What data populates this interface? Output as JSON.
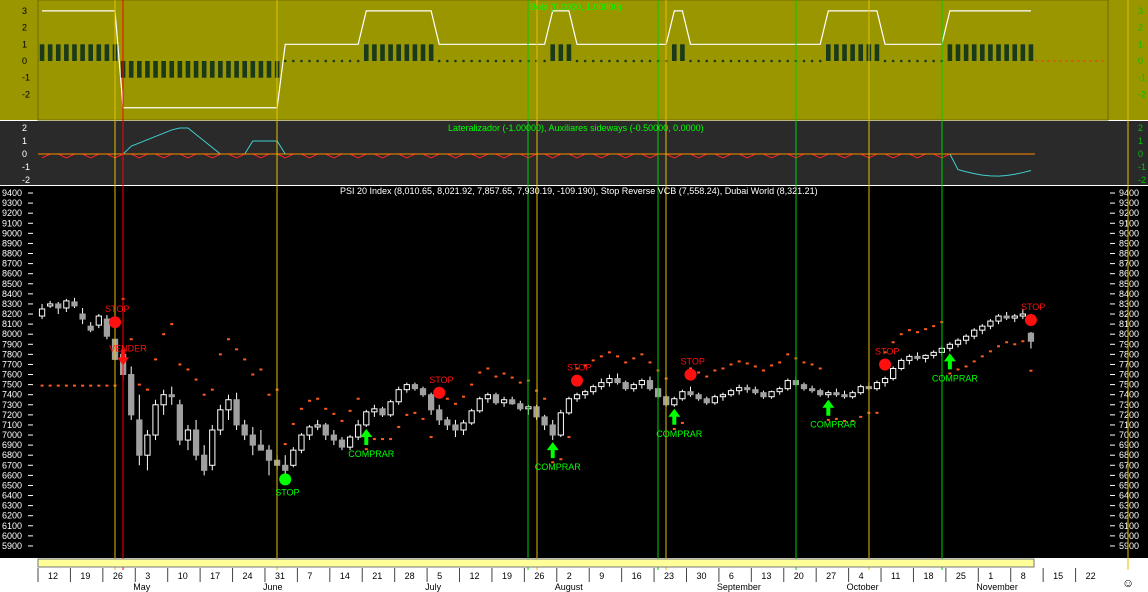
{
  "panels": {
    "top_label": "Bobi (0.0000, 1.00000)",
    "mid_label": "Lateralizador (-1.00000), Auxiliares sideways (-0.50000, 0.0000)",
    "main_label": "PSI 20 Index (8,010.65, 8,021.92, 7,857.65, 7,930.19, -109.190), Stop Reverse VCB (7,558.24), Dubai World (8,321.21)"
  },
  "colors": {
    "olive": "#9a9600",
    "mid_bg": "#2a2a2a",
    "main_bg": "#000000",
    "signal_green": "#00ff00",
    "stop_red": "#ff1010",
    "stop_dots": "#ff5a1e",
    "vline_yellow": "#e0c000",
    "vline_green": "#00d000",
    "vline_red": "#ff0000"
  },
  "chart_data": {
    "type": "candlestick",
    "title": "PSI 20 Index (8,010.65, 8,021.92, 7,857.65, 7,930.19, -109.190), Stop Reverse VCB (7,558.24), Dubai World (8,321.21)",
    "y_ticks": [
      9400,
      9300,
      9200,
      9100,
      9000,
      8900,
      8800,
      8700,
      8600,
      8500,
      8400,
      8300,
      8200,
      8100,
      8000,
      7900,
      7800,
      7700,
      7600,
      7500,
      7400,
      7300,
      7200,
      7100,
      7000,
      6900,
      6800,
      6700,
      6600,
      6500,
      6400,
      6300,
      6200,
      6100,
      6000,
      5900
    ],
    "ylim": [
      5850,
      9420
    ],
    "x_day_labels": [
      "12",
      "19",
      "26",
      "3",
      "10",
      "17",
      "24",
      "31",
      "7",
      "14",
      "21",
      "28",
      "5",
      "12",
      "19",
      "26",
      "2",
      "9",
      "16",
      "23",
      "30",
      "6",
      "13",
      "20",
      "27",
      "4",
      "11",
      "18",
      "25",
      "1",
      "8",
      "15",
      "22"
    ],
    "month_labels": [
      "May",
      "June",
      "July",
      "August",
      "September",
      "October",
      "November"
    ],
    "top_panel": {
      "y_ticks": [
        "3",
        "2",
        "1",
        "0",
        "-1",
        "-2"
      ]
    },
    "mid_panel": {
      "y_ticks": [
        "2",
        "1",
        "0",
        "-1",
        "-2"
      ]
    },
    "candles": [
      [
        8180,
        8300,
        8150,
        8250
      ],
      [
        8280,
        8330,
        8260,
        8300
      ],
      [
        8300,
        8320,
        8200,
        8260
      ],
      [
        8260,
        8350,
        8220,
        8330
      ],
      [
        8320,
        8360,
        8260,
        8280
      ],
      [
        8200,
        8260,
        8100,
        8150
      ],
      [
        8080,
        8120,
        8020,
        8040
      ],
      [
        8090,
        8200,
        8060,
        8180
      ],
      [
        8150,
        8190,
        7950,
        7980
      ],
      [
        7950,
        8000,
        7700,
        7750
      ],
      [
        7800,
        7850,
        7550,
        7600
      ],
      [
        7600,
        7680,
        7150,
        7200
      ],
      [
        7150,
        7400,
        6700,
        6800
      ],
      [
        6800,
        7050,
        6650,
        7000
      ],
      [
        7000,
        7350,
        6950,
        7300
      ],
      [
        7300,
        7450,
        7200,
        7400
      ],
      [
        7400,
        7480,
        7300,
        7380
      ],
      [
        7300,
        7350,
        6900,
        6950
      ],
      [
        6950,
        7100,
        6850,
        7050
      ],
      [
        7050,
        7150,
        6750,
        6800
      ],
      [
        6800,
        6900,
        6600,
        6650
      ],
      [
        6700,
        7100,
        6650,
        7050
      ],
      [
        7050,
        7300,
        7000,
        7250
      ],
      [
        7250,
        7400,
        7150,
        7350
      ],
      [
        7350,
        7420,
        7050,
        7100
      ],
      [
        7100,
        7150,
        6950,
        7000
      ],
      [
        7000,
        7080,
        6800,
        6900
      ],
      [
        6900,
        7050,
        6850,
        6850
      ],
      [
        6850,
        6900,
        6600,
        6750
      ],
      [
        6750,
        6800,
        6650,
        6700
      ],
      [
        6700,
        6800,
        6600,
        6650
      ],
      [
        6700,
        6880,
        6680,
        6850
      ],
      [
        6850,
        7020,
        6820,
        7000
      ],
      [
        7000,
        7100,
        6950,
        7080
      ],
      [
        7080,
        7150,
        7050,
        7100
      ],
      [
        7100,
        7120,
        6950,
        7000
      ],
      [
        7000,
        7050,
        6900,
        6950
      ],
      [
        6950,
        6980,
        6850,
        6880
      ],
      [
        6880,
        7000,
        6850,
        6980
      ],
      [
        6980,
        7150,
        6950,
        7100
      ],
      [
        7100,
        7250,
        7080,
        7230
      ],
      [
        7230,
        7300,
        7180,
        7260
      ],
      [
        7260,
        7280,
        7180,
        7200
      ],
      [
        7200,
        7350,
        7180,
        7330
      ],
      [
        7330,
        7480,
        7300,
        7450
      ],
      [
        7450,
        7520,
        7420,
        7500
      ],
      [
        7500,
        7520,
        7440,
        7460
      ],
      [
        7460,
        7480,
        7380,
        7400
      ],
      [
        7400,
        7420,
        7200,
        7250
      ],
      [
        7250,
        7300,
        7100,
        7150
      ],
      [
        7150,
        7180,
        7050,
        7100
      ],
      [
        7100,
        7150,
        6980,
        7050
      ],
      [
        7050,
        7150,
        7000,
        7120
      ],
      [
        7120,
        7260,
        7100,
        7240
      ],
      [
        7240,
        7380,
        7220,
        7360
      ],
      [
        7360,
        7420,
        7320,
        7400
      ],
      [
        7400,
        7420,
        7300,
        7320
      ],
      [
        7320,
        7380,
        7280,
        7350
      ],
      [
        7350,
        7380,
        7300,
        7310
      ],
      [
        7310,
        7340,
        7240,
        7260
      ],
      [
        7260,
        7300,
        7200,
        7280
      ],
      [
        7280,
        7300,
        7150,
        7180
      ],
      [
        7180,
        7200,
        7050,
        7100
      ],
      [
        7100,
        7150,
        6950,
        7000
      ],
      [
        7000,
        7250,
        6980,
        7220
      ],
      [
        7220,
        7380,
        7200,
        7360
      ],
      [
        7360,
        7420,
        7330,
        7400
      ],
      [
        7400,
        7450,
        7360,
        7430
      ],
      [
        7430,
        7500,
        7400,
        7480
      ],
      [
        7480,
        7560,
        7450,
        7520
      ],
      [
        7520,
        7600,
        7480,
        7560
      ],
      [
        7560,
        7610,
        7500,
        7520
      ],
      [
        7520,
        7540,
        7440,
        7460
      ],
      [
        7460,
        7520,
        7430,
        7500
      ],
      [
        7500,
        7560,
        7460,
        7540
      ],
      [
        7540,
        7580,
        7440,
        7460
      ],
      [
        7460,
        7480,
        7360,
        7380
      ],
      [
        7380,
        7400,
        7280,
        7300
      ],
      [
        7300,
        7380,
        7280,
        7360
      ],
      [
        7360,
        7450,
        7340,
        7430
      ],
      [
        7430,
        7480,
        7380,
        7400
      ],
      [
        7400,
        7420,
        7340,
        7360
      ],
      [
        7360,
        7380,
        7300,
        7320
      ],
      [
        7320,
        7400,
        7300,
        7380
      ],
      [
        7380,
        7420,
        7340,
        7400
      ],
      [
        7400,
        7460,
        7380,
        7440
      ],
      [
        7440,
        7500,
        7400,
        7470
      ],
      [
        7470,
        7500,
        7420,
        7450
      ],
      [
        7450,
        7480,
        7400,
        7420
      ],
      [
        7420,
        7440,
        7360,
        7380
      ],
      [
        7380,
        7440,
        7360,
        7430
      ],
      [
        7430,
        7480,
        7400,
        7460
      ],
      [
        7460,
        7560,
        7440,
        7540
      ],
      [
        7540,
        7580,
        7480,
        7500
      ],
      [
        7500,
        7520,
        7440,
        7460
      ],
      [
        7460,
        7490,
        7420,
        7440
      ],
      [
        7440,
        7460,
        7380,
        7400
      ],
      [
        7400,
        7440,
        7370,
        7420
      ],
      [
        7420,
        7460,
        7380,
        7400
      ],
      [
        7400,
        7440,
        7360,
        7380
      ],
      [
        7380,
        7440,
        7360,
        7420
      ],
      [
        7420,
        7500,
        7400,
        7480
      ],
      [
        7480,
        7520,
        7440,
        7460
      ],
      [
        7460,
        7540,
        7440,
        7520
      ],
      [
        7520,
        7580,
        7480,
        7560
      ],
      [
        7560,
        7680,
        7540,
        7660
      ],
      [
        7660,
        7760,
        7640,
        7740
      ],
      [
        7740,
        7800,
        7700,
        7780
      ],
      [
        7780,
        7820,
        7740,
        7760
      ],
      [
        7760,
        7800,
        7720,
        7790
      ],
      [
        7790,
        7840,
        7760,
        7820
      ],
      [
        7820,
        7880,
        7790,
        7860
      ],
      [
        7860,
        7920,
        7830,
        7900
      ],
      [
        7900,
        7960,
        7870,
        7940
      ],
      [
        7940,
        8000,
        7900,
        7980
      ],
      [
        7980,
        8060,
        7950,
        8040
      ],
      [
        8040,
        8100,
        8000,
        8080
      ],
      [
        8080,
        8150,
        8050,
        8130
      ],
      [
        8130,
        8200,
        8100,
        8180
      ],
      [
        8180,
        8220,
        8140,
        8160
      ],
      [
        8160,
        8200,
        8120,
        8180
      ],
      [
        8180,
        8250,
        8150,
        8200
      ],
      [
        8010,
        8022,
        7858,
        7930
      ]
    ],
    "signals": [
      {
        "type": "vender",
        "index": 10,
        "text": "VENDER"
      },
      {
        "type": "stop-red",
        "index": 9,
        "text": "STOP"
      },
      {
        "type": "stop-green",
        "index": 30,
        "text": "STOP"
      },
      {
        "type": "comprar",
        "index": 40,
        "text": "COMPRAR"
      },
      {
        "type": "stop-red",
        "index": 49,
        "text": "STOP"
      },
      {
        "type": "comprar",
        "index": 63,
        "text": "COMPRAR"
      },
      {
        "type": "stop-red",
        "index": 66,
        "text": "STOP"
      },
      {
        "type": "comprar",
        "index": 78,
        "text": "COMPRAR"
      },
      {
        "type": "stop-red",
        "index": 80,
        "text": "STOP"
      },
      {
        "type": "comprar",
        "index": 97,
        "text": "COMPRAR"
      },
      {
        "type": "stop-red",
        "index": 104,
        "text": "STOP"
      },
      {
        "type": "comprar",
        "index": 112,
        "text": "COMPRAR"
      },
      {
        "type": "stop-red",
        "index": 134,
        "text": "STOP"
      }
    ]
  }
}
